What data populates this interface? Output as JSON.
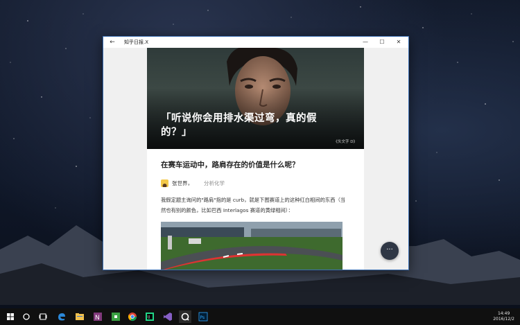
{
  "window": {
    "title": "知乎日报.X",
    "back_icon": "back-arrow-icon",
    "minimize_icon": "minimize-icon",
    "maximize_icon": "maximize-icon",
    "close_icon": "close-icon",
    "accent": "#3b6fb3"
  },
  "article": {
    "hero_title": "「听说你会用排水渠过弯，真的假的？」",
    "hero_credit": "《头文字 D》",
    "question_title": "在赛车运动中，路肩存在的价值是什么呢？",
    "author_name": "张世界，",
    "author_bio": "分析化学",
    "body_text": "我假定题主询问的\"路肩\"指的是 curb，就是下图赛道上的这种红白相间的东西（当然也有别的颜色，比如巴西 Interlagos 赛道的黄绿相间）：",
    "fab_label": "···"
  },
  "taskbar": {
    "icons": [
      "windows-start-icon",
      "search-icon",
      "task-view-icon",
      "edge-icon",
      "file-explorer-icon",
      "onenote-icon",
      "app-green-icon",
      "chrome-icon",
      "intellij-icon",
      "visual-studio-icon",
      "zhihu-daily-icon",
      "photoshop-icon"
    ],
    "time": "14:49",
    "date": "2016/12/2"
  }
}
